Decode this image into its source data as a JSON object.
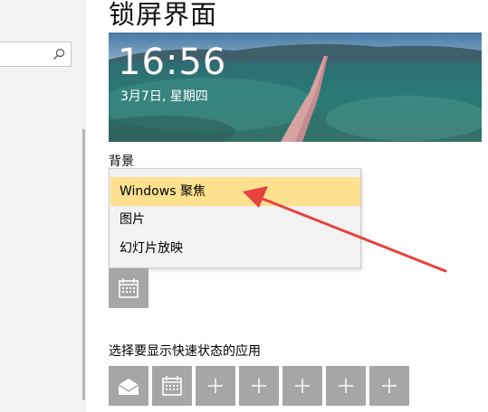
{
  "page": {
    "title": "锁屏界面"
  },
  "preview": {
    "time": "16:56",
    "date": "3月7日, 星期四"
  },
  "background": {
    "label": "背景",
    "options": [
      "Windows 聚焦",
      "图片",
      "幻灯片放映"
    ],
    "selected": "Windows 聚焦"
  },
  "detailed_status_icon": "calendar-icon",
  "quick_status": {
    "label": "选择要显示快速状态的应用",
    "tiles": [
      "mail-icon",
      "calendar-icon",
      "plus-icon",
      "plus-icon",
      "plus-icon",
      "plus-icon",
      "plus-icon"
    ]
  },
  "colors": {
    "highlight": "#fde18f",
    "tile": "#a6a6a6",
    "arrow": "#e8413b"
  }
}
